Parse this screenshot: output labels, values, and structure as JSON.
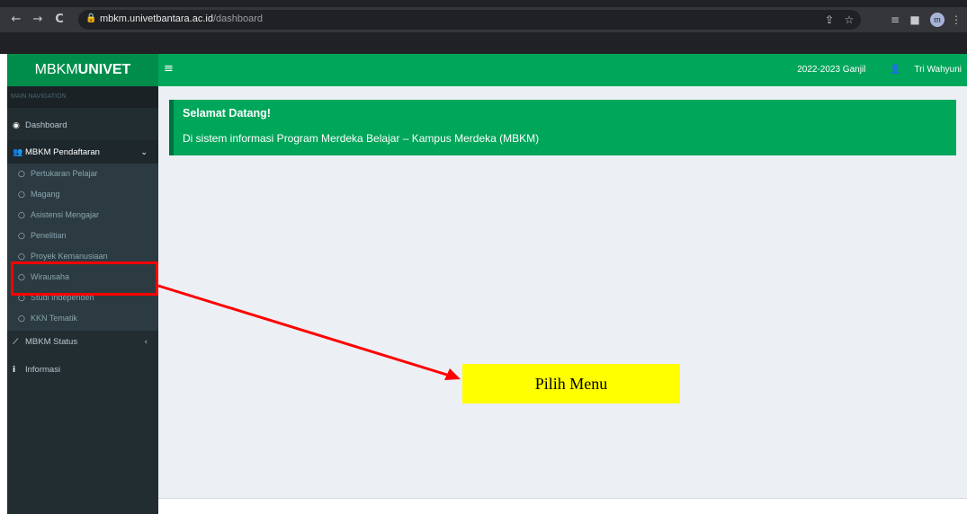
{
  "browser": {
    "nav_back": "←",
    "nav_forward": "→",
    "nav_reload": "C",
    "url_host": "mbkm.univetbantara.ac.id",
    "url_path": "/dashboard",
    "profile_initial": "m"
  },
  "app": {
    "logo_prefix": "MBKM",
    "logo_bold": "UNIVET",
    "semester": "2022-2023 Ganjil",
    "user_name": "Tri Wahyuni"
  },
  "sidebar": {
    "header": "MAIN NAVIGATION",
    "dashboard": "Dashboard",
    "pendaftaran": "MBKM Pendaftaran",
    "sub_items": [
      "Pertukaran Pelajar",
      "Magang",
      "Asistensi Mengajar",
      "Penelitian",
      "Proyek Kemanusiaan",
      "Wirausaha",
      "Studi Independen",
      "KKN Tematik"
    ],
    "status": "MBKM Status",
    "informasi": "Informasi"
  },
  "welcome": {
    "title": "Selamat Datang!",
    "message": "Di sistem informasi Program Merdeka Belajar – Kampus Merdeka (MBKM)"
  },
  "annotation": {
    "label": "Pilih Menu"
  },
  "colors": {
    "brand_green": "#00a65a",
    "sidebar_dark": "#222d32",
    "highlight_red": "#ff0000",
    "label_yellow": "#ffff00"
  }
}
